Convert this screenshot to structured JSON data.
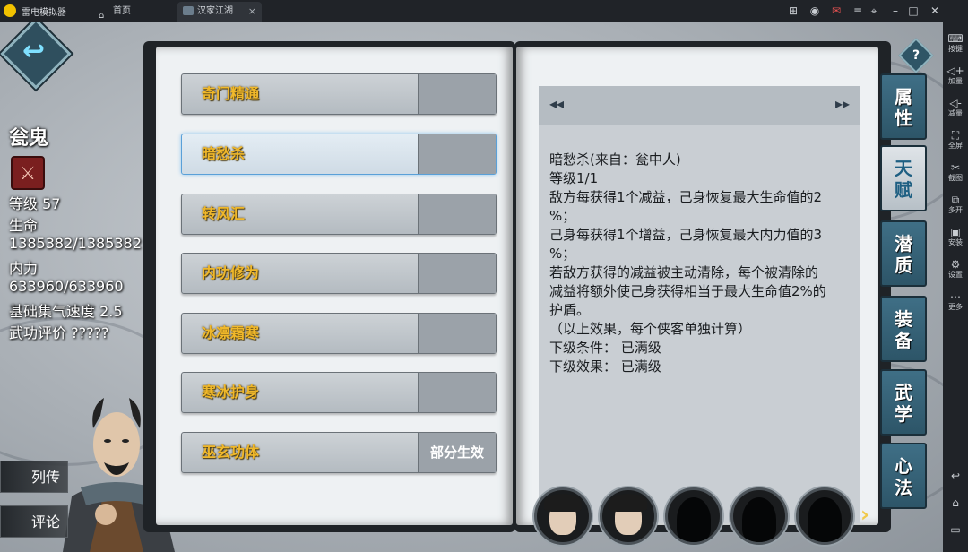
{
  "emulator": {
    "app_name": "雷电模拟器",
    "tabs": [
      {
        "label": "首页"
      },
      {
        "label": "汉家江湖"
      }
    ],
    "sidebar": [
      {
        "icon": "keyboard-icon",
        "label": "按键"
      },
      {
        "icon": "volume-up-icon",
        "label": "加量"
      },
      {
        "icon": "volume-down-icon",
        "label": "减量"
      },
      {
        "icon": "fullscreen-icon",
        "label": "全屏"
      },
      {
        "icon": "scissors-icon",
        "label": "截图"
      },
      {
        "icon": "multi-open-icon",
        "label": "多开"
      },
      {
        "icon": "apk-install-icon",
        "label": "安装"
      },
      {
        "icon": "gear-icon",
        "label": "设置"
      },
      {
        "icon": "more-icon",
        "label": "更多"
      }
    ]
  },
  "character": {
    "name": "瓮鬼",
    "stats": [
      "等级 57",
      "生命",
      "1385382/1385382",
      "内力",
      "633960/633960",
      "基础集气速度 2.5",
      "武功评价 ?????"
    ],
    "buttons": {
      "biography": "列传",
      "comment": "评论"
    }
  },
  "skills": [
    {
      "name": "奇门精通",
      "value": ""
    },
    {
      "name": "暗愁杀",
      "value": "",
      "selected": true
    },
    {
      "name": "转风汇",
      "value": ""
    },
    {
      "name": "内功修为",
      "value": ""
    },
    {
      "name": "冰凛霜寒",
      "value": ""
    },
    {
      "name": "寒冰护身",
      "value": ""
    },
    {
      "name": "巫玄功体",
      "value": "部分生效"
    }
  ],
  "detail": {
    "lines": [
      "暗愁杀(来自：瓮中人)",
      "等级1/1",
      "",
      "敌方每获得1个减益，己身恢复最大生命值的2",
      "%；",
      "己身每获得1个增益，己身恢复最大内力值的3",
      "%；",
      "若敌方获得的减益被主动清除，每个被清除的",
      "减益将额外使己身获得相当于最大生命值2%的",
      "护盾。",
      "（以上效果，每个侠客单独计算）",
      "",
      "",
      "下级条件： 已满级",
      "下级效果： 已满级"
    ]
  },
  "side_tabs": [
    {
      "label": "属性"
    },
    {
      "label": "天赋",
      "active": true
    },
    {
      "label": "潜质"
    },
    {
      "label": "装备"
    },
    {
      "label": "武学"
    },
    {
      "label": "心法"
    }
  ],
  "help_label": "?",
  "colors": {
    "skill_name": "#f0b82a",
    "tab_bg": "#2d5568",
    "selected_border": "#5aa0d8"
  }
}
